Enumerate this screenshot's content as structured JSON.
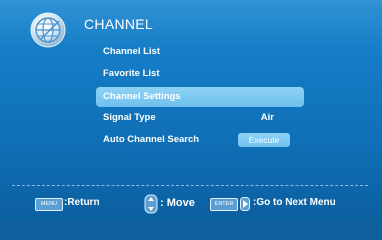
{
  "header": {
    "title": "CHANNEL",
    "icon": "globe-icon"
  },
  "menu": {
    "items": [
      {
        "label": "Channel List",
        "value": ""
      },
      {
        "label": "Favorite List",
        "value": ""
      },
      {
        "label": "Channel Settings",
        "value": "",
        "selected": true
      },
      {
        "label": "Signal Type",
        "value": "Air"
      },
      {
        "label": "Auto Channel Search",
        "value": ""
      }
    ],
    "execute_label": "Execute"
  },
  "footer": {
    "menu_key": "MENU",
    "return_label": ":Return",
    "move_label": ": Move",
    "enter_key": "ENTER",
    "next_label": ":Go to Next Menu"
  },
  "colors": {
    "background": "#147bc4",
    "highlight": "#7ec8f0",
    "text": "#ffffff"
  }
}
